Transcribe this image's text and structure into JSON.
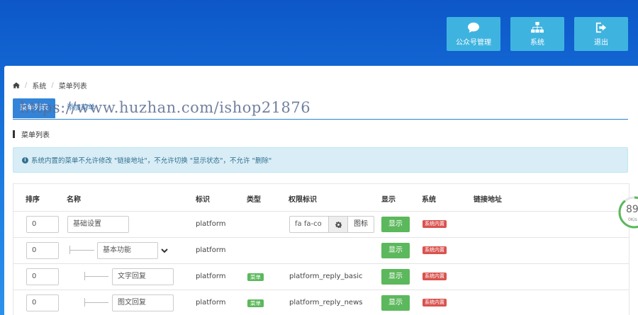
{
  "topnav": {
    "items": [
      {
        "label": "公众号管理",
        "icon": "chat-icon"
      },
      {
        "label": "系统",
        "icon": "sitemap-icon"
      },
      {
        "label": "退出",
        "icon": "logout-icon"
      }
    ]
  },
  "breadcrumb": {
    "home_icon": "home-icon",
    "items": [
      "系统",
      "菜单列表"
    ]
  },
  "tabs": [
    {
      "label": "菜单列表"
    },
    {
      "label": "添加菜单"
    }
  ],
  "watermark": "https://www.huzhan.com/ishop21876",
  "section": {
    "title": "菜单列表"
  },
  "alert": {
    "text": "系统内置的菜单不允许修改 \"链接地址\"，不允许切换 \"显示状态\"，不允许 \"删除\""
  },
  "table": {
    "headers": [
      "排序",
      "名称",
      "标识",
      "类型",
      "权限标识",
      "显示",
      "系统",
      "链接地址"
    ],
    "rows": [
      {
        "sort": "0",
        "name": "基础设置",
        "ident": "platform",
        "type": "",
        "perm": "",
        "icon_value": "fa fa-co",
        "icon_btn": "图标",
        "show": "显示",
        "system": "系统内置",
        "level": 0
      },
      {
        "sort": "0",
        "name": "基本功能",
        "ident": "platform",
        "type": "",
        "perm": "",
        "show": "显示",
        "system": "系统内置",
        "level": 1
      },
      {
        "sort": "0",
        "name": "文字回复",
        "ident": "platform",
        "type": "菜单",
        "perm": "platform_reply_basic",
        "show": "显示",
        "system": "系统内置",
        "level": 2
      },
      {
        "sort": "0",
        "name": "图文回复",
        "ident": "platform",
        "type": "菜单",
        "perm": "platform_reply_news",
        "show": "显示",
        "system": "系统内置",
        "level": 2
      }
    ]
  },
  "gauge": {
    "value": "89",
    "sub": "0K/s",
    "percent": 89,
    "color": "#5cb85c"
  }
}
